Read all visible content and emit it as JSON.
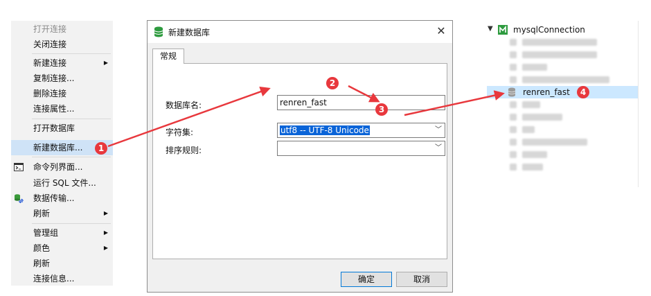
{
  "context_menu": {
    "items": [
      {
        "label": "打开连接",
        "disabled": true
      },
      {
        "label": "关闭连接"
      },
      {
        "label": "新建连接",
        "submenu": true
      },
      {
        "label": "复制连接..."
      },
      {
        "label": "删除连接"
      },
      {
        "label": "连接属性..."
      },
      {
        "label": "打开数据库"
      },
      {
        "label": "新建数据库...",
        "highlighted": true
      },
      {
        "label": "命令列界面...",
        "icon": "console-icon"
      },
      {
        "label": "运行 SQL 文件..."
      },
      {
        "label": "数据传输...",
        "icon": "data-transfer-icon"
      },
      {
        "label": "刷新",
        "submenu": true
      },
      {
        "label": "管理组",
        "submenu": true
      },
      {
        "label": "颜色",
        "submenu": true
      },
      {
        "label": "刷新"
      },
      {
        "label": "连接信息..."
      }
    ]
  },
  "dialog": {
    "title": "新建数据库",
    "icon": "database-icon",
    "close_glyph": "✕",
    "tab": "常规",
    "fields": {
      "db_name_label": "数据库名:",
      "db_name_value": "renren_fast",
      "charset_label": "字符集:",
      "charset_value": "utf8 -- UTF-8 Unicode",
      "collation_label": "排序规则:",
      "collation_value": ""
    },
    "ok_label": "确定",
    "cancel_label": "取消"
  },
  "tree": {
    "connection_label": "mysqlConnection",
    "selected_db_label": "renren_fast"
  },
  "annotations": {
    "step1": "1",
    "step2": "2",
    "step3": "3",
    "step4": "4"
  },
  "colors": {
    "accent_red": "#e8383d",
    "selection_blue": "#0a64d8",
    "menu_highlight": "#cfe3f7",
    "tree_selection": "#cce8ff"
  }
}
